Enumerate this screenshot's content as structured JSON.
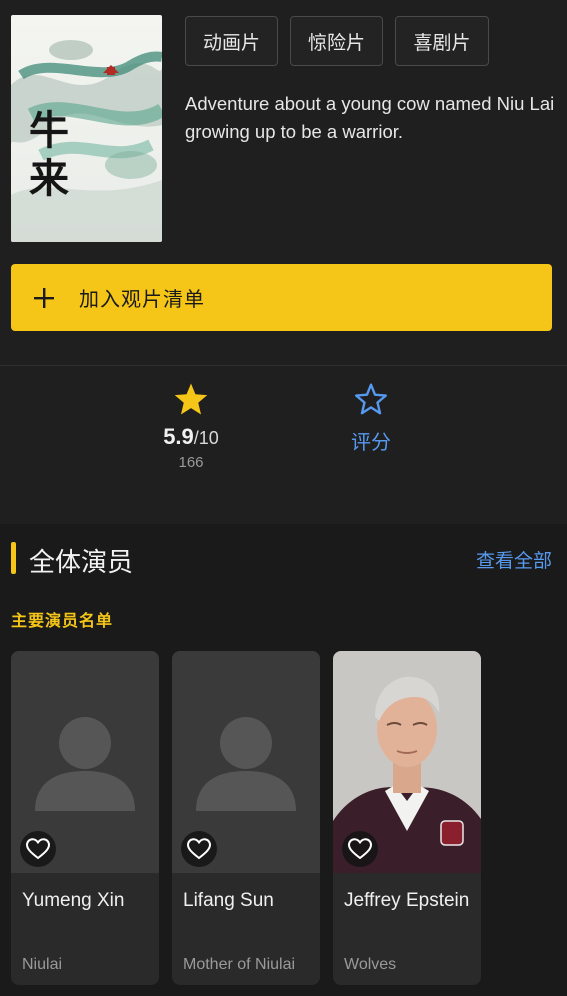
{
  "movie": {
    "poster_title": "牛来",
    "genres": [
      "动画片",
      "惊险片",
      "喜剧片"
    ],
    "description": "Adventure about a young cow named Niu Lai growing up to be a warrior.",
    "watchlist_label": "加入观片清单",
    "watchlist_icon": "plus-icon"
  },
  "rating": {
    "score": "5.9",
    "out_of": "/10",
    "votes": "166",
    "rate_label": "评分",
    "star_color": "#f5c518",
    "rate_color": "#5799ef"
  },
  "cast": {
    "title": "全体演员",
    "see_all": "查看全部",
    "subhead": "主要演员名单",
    "members": [
      {
        "name": "Yumeng Xin",
        "role": "Niulai",
        "photo": "placeholder-avatar"
      },
      {
        "name": "Lifang Sun",
        "role": "Mother of Niulai",
        "photo": "placeholder-avatar"
      },
      {
        "name": "Jeffrey Epstein",
        "role": "Wolves",
        "photo": "person-photo"
      }
    ]
  },
  "colors": {
    "accent": "#f5c518",
    "link": "#5799ef",
    "background": "#1f1f1f"
  }
}
